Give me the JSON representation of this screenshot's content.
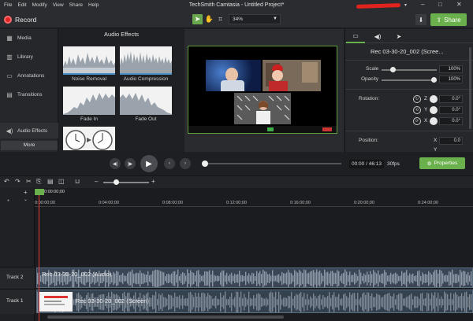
{
  "menu": {
    "items": [
      "File",
      "Edit",
      "Modify",
      "View",
      "Share",
      "Help"
    ]
  },
  "title": "TechSmith Camtasia - Untitled Project*",
  "toolbar": {
    "record_label": "Record",
    "zoom": "34%",
    "share_label": "Share"
  },
  "sidebar": {
    "items": [
      {
        "label": "Media",
        "icon": "media-icon"
      },
      {
        "label": "Library",
        "icon": "library-icon"
      },
      {
        "label": "Annotations",
        "icon": "annotations-icon"
      },
      {
        "label": "Transitions",
        "icon": "transitions-icon"
      },
      {
        "label": "Audio Effects",
        "icon": "audio-effects-icon"
      }
    ],
    "more_label": "More"
  },
  "effects": {
    "title": "Audio Effects",
    "items": [
      "Noise Removal",
      "Audio Compression",
      "Fade In",
      "Fade Out"
    ]
  },
  "properties": {
    "clip_name": "Rec 03-30-20_002 (Scree...",
    "scale_label": "Scale",
    "scale_value": "100%",
    "opacity_label": "Opacity",
    "opacity_value": "100%",
    "rotation_label": "Rotation:",
    "rotation": [
      {
        "axis": "Z",
        "value": "0.0°"
      },
      {
        "axis": "Y",
        "value": "0.0°"
      },
      {
        "axis": "X",
        "value": "0.0°"
      }
    ],
    "position_label": "Position:",
    "position": [
      {
        "axis": "X",
        "value": "0.0"
      },
      {
        "axis": "Y",
        "value": ""
      }
    ]
  },
  "playback": {
    "time": "00:00 / 46:13",
    "fps": "30fps",
    "properties_label": "Properties",
    "scrub_fraction": 0
  },
  "timeline": {
    "ruler": [
      "0:00:00;00",
      "0:04:00;00",
      "0:08:00;00",
      "0:12:00;00",
      "0:16:00;00",
      "0:20:00;00",
      "0:24:00;00"
    ],
    "playhead_time": "0:00:00;00",
    "tracks": [
      {
        "label": "Track 2",
        "clip": "Rec 03-30-20_002 (Audio)"
      },
      {
        "label": "Track 1",
        "clip": "Rec 03-30-20_002 (Screen)"
      }
    ]
  },
  "colors": {
    "accent": "#6ab04c",
    "record": "#e02424",
    "background": "#1e1f22",
    "clip": "#3b4c5c"
  }
}
